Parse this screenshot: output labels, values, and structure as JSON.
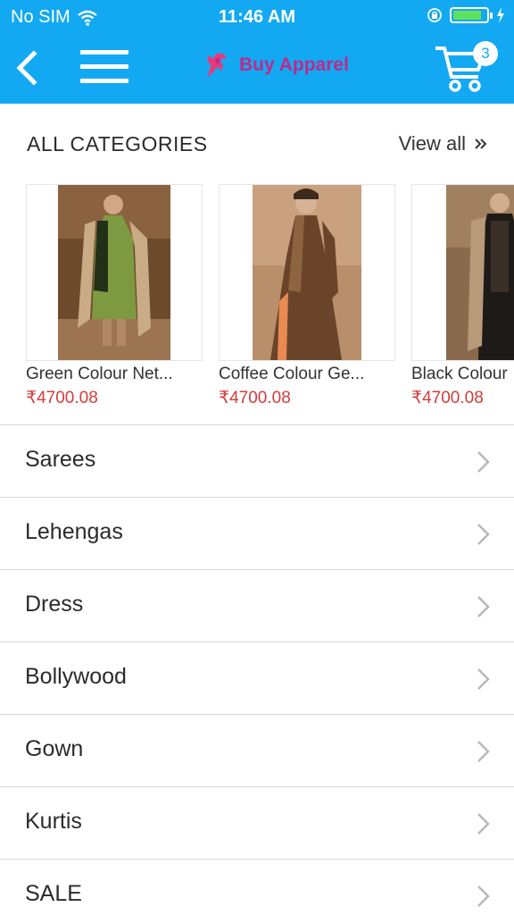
{
  "status_bar": {
    "carrier": "No SIM",
    "time": "11:46 AM",
    "battery_level": 0.85,
    "battery_color": "#5ee25e"
  },
  "navbar": {
    "brand_name": "Buy Apparel",
    "cart_count": "3",
    "bar_color": "#13a9f2",
    "brand_color": "#c0288a",
    "icons": [
      "back-icon",
      "hamburger-menu-icon",
      "brand-logo-icon",
      "cart-icon"
    ]
  },
  "categories_section": {
    "title": "ALL CATEGORIES",
    "view_all_label": "View all"
  },
  "products": [
    {
      "name": "Green Colour Net...",
      "price": "₹4700.08"
    },
    {
      "name": "Coffee Colour Ge...",
      "price": "₹4700.08"
    },
    {
      "name": "Black Colour",
      "price": "₹4700.08"
    }
  ],
  "price_color": "#d63a3a",
  "category_list": [
    {
      "label": "Sarees"
    },
    {
      "label": "Lehengas"
    },
    {
      "label": "Dress"
    },
    {
      "label": "Bollywood"
    },
    {
      "label": "Gown"
    },
    {
      "label": "Kurtis"
    },
    {
      "label": "SALE"
    }
  ]
}
